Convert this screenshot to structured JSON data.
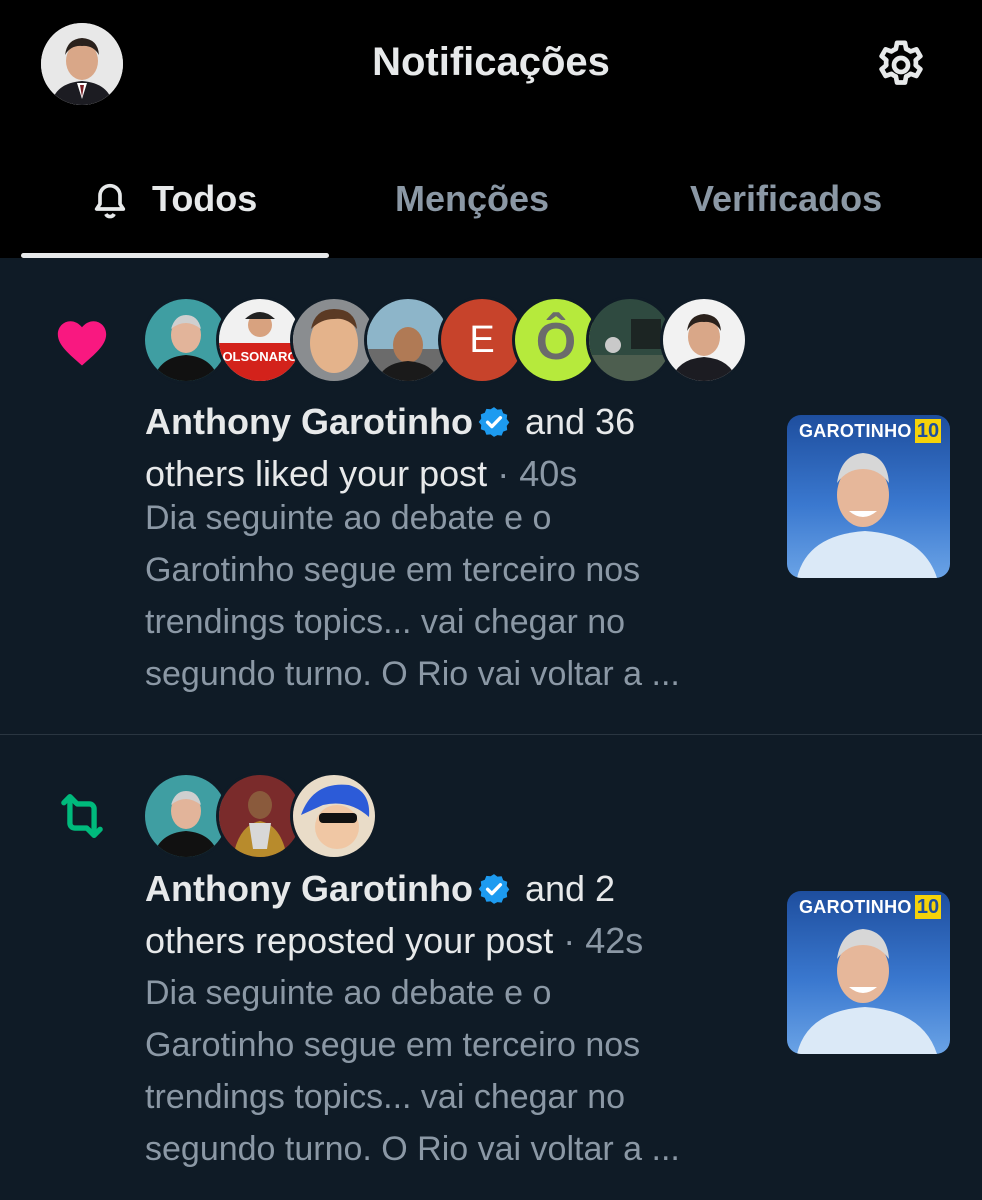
{
  "header": {
    "title": "Notificações"
  },
  "tabs": [
    {
      "label": "Todos",
      "active": true
    },
    {
      "label": "Menções",
      "active": false
    },
    {
      "label": "Verificados",
      "active": false
    }
  ],
  "colors": {
    "background": "#0f1b26",
    "topbar": "#000000",
    "like": "#f91880",
    "repost": "#00ba7c",
    "verified": "#1d9bf0",
    "muted_text": "#8b98a5"
  },
  "notifications": [
    {
      "type": "like",
      "icon": "heart-icon",
      "actor": "Anthony Garotinho",
      "suffix": "and 36",
      "line2": "others liked your post",
      "time": "· 40s",
      "snippet": [
        "Dia seguinte ao debate e o",
        "Garotinho segue em terceiro nos",
        "trendings topics... vai chegar no",
        "segundo turno. O Rio vai voltar a ..."
      ],
      "avatar_count": 8,
      "thumb_text": "GAROTINHO",
      "thumb_num": "10",
      "avatar_labels": [
        "",
        "OLSONARO",
        "",
        "",
        "E",
        "Ô",
        "",
        ""
      ]
    },
    {
      "type": "repost",
      "icon": "repost-icon",
      "actor": "Anthony Garotinho",
      "suffix": "and 2",
      "line2": "others reposted your post",
      "time": "· 42s",
      "snippet": [
        "Dia seguinte ao debate e o",
        "Garotinho segue em terceiro nos",
        "trendings topics... vai chegar no",
        "segundo turno. O Rio vai voltar a ..."
      ],
      "avatar_count": 3,
      "thumb_text": "GAROTINHO",
      "thumb_num": "10"
    }
  ]
}
